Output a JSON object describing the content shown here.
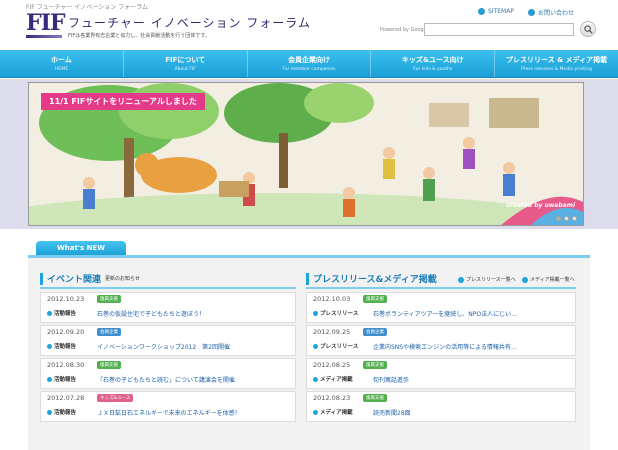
{
  "header": {
    "caption": "FIF フューチャー イノベーション フォーラム",
    "logo_text": "FIF",
    "title": "フューチャー イノベーション フォーラム",
    "subtitle": "FIFは各業界有志企業と協力し、社会貢献活動を行う団体です。",
    "sitemap_label": "SITEMAP",
    "contact_label": "お問い合わせ",
    "search_powered": "Powered by Google",
    "search_value": ""
  },
  "nav": [
    {
      "label": "ホーム",
      "sub": "HOME"
    },
    {
      "label": "FIFについて",
      "sub": "About FIF"
    },
    {
      "label": "会員企業向け",
      "sub": "For member companies"
    },
    {
      "label": "キッズ&ユース向け",
      "sub": "For kids & youths"
    },
    {
      "label": "プレスリリース & メディア掲載",
      "sub": "Press releases & Media printing"
    }
  ],
  "hero": {
    "banner": "11/1 FIFサイトをリニューアルしました",
    "credit": "created by uwabami"
  },
  "whatsnew": {
    "tab": "What's NEW",
    "events": {
      "title": "イベント関連",
      "sub": "更新のお知らせ",
      "items": [
        {
          "date": "2012.10.23",
          "badge": "復興支援",
          "badge_color": "green",
          "category": "活動報告",
          "title": "石巻の仮設住宅で子どもたちと遊ぼう！"
        },
        {
          "date": "2012.09.20",
          "badge": "会員企業",
          "badge_color": "blue",
          "category": "活動報告",
          "title": "イノベーションワークショップ2012　第2回開催"
        },
        {
          "date": "2012.08.30",
          "badge": "復興支援",
          "badge_color": "green",
          "category": "活動報告",
          "title": "「石巻の子どもたちと読む」について講演会を開催"
        },
        {
          "date": "2012.07.28",
          "badge": "キッズ&ユース",
          "badge_color": "pink",
          "category": "活動報告",
          "title": "ＪＸ日鉱日石エネルギーで未来のエネルギーを体感！"
        }
      ]
    },
    "press": {
      "title": "プレスリリース&メディア掲載",
      "link_press": "プレスリリース一覧へ",
      "link_media": "メディア掲載一覧へ",
      "items": [
        {
          "date": "2012.10.03",
          "badge": "復興支援",
          "badge_color": "green",
          "category": "プレスリリース",
          "title": "石巻ボランティアツアーを継続し、NPO法人にじい…"
        },
        {
          "date": "2012.09.25",
          "badge": "会員企業",
          "badge_color": "blue",
          "category": "プレスリリース",
          "title": "企業内SNSや検索エンジンの活用等による情報共有…"
        },
        {
          "date": "2012.08.25",
          "badge": "復興支援",
          "badge_color": "green",
          "category": "メディア掲載",
          "title": "旬刊寓話進歩"
        },
        {
          "date": "2012.08.23",
          "badge": "復興支援",
          "badge_color": "green",
          "category": "メディア掲載",
          "title": "読売新聞28面"
        }
      ]
    }
  },
  "colors": {
    "nav_blue": "#1a9fd8",
    "accent_pink": "#e53a8a",
    "link_blue": "#1d5fa8",
    "logo_purple": "#3a2b7a"
  }
}
